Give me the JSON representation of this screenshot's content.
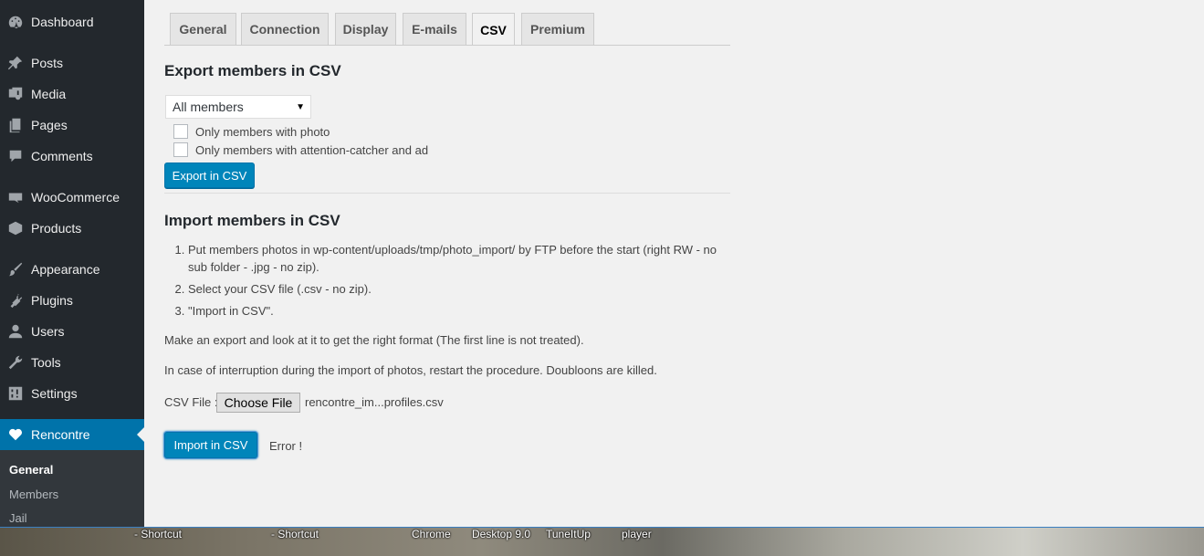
{
  "sidebar": {
    "items": [
      {
        "label": "Dashboard",
        "icon": "dashboard-icon"
      },
      {
        "label": "Posts",
        "icon": "pin-icon"
      },
      {
        "label": "Media",
        "icon": "media-icon"
      },
      {
        "label": "Pages",
        "icon": "pages-icon"
      },
      {
        "label": "Comments",
        "icon": "comment-icon"
      },
      {
        "label": "WooCommerce",
        "icon": "woocommerce-icon"
      },
      {
        "label": "Products",
        "icon": "products-icon"
      },
      {
        "label": "Appearance",
        "icon": "brush-icon"
      },
      {
        "label": "Plugins",
        "icon": "plug-icon"
      },
      {
        "label": "Users",
        "icon": "user-icon"
      },
      {
        "label": "Tools",
        "icon": "wrench-icon"
      },
      {
        "label": "Settings",
        "icon": "settings-icon"
      },
      {
        "label": "Rencontre",
        "icon": "heart-icon"
      }
    ],
    "submenu": [
      "General",
      "Members",
      "Jail"
    ]
  },
  "tabs": [
    "General",
    "Connection",
    "Display",
    "E-mails",
    "CSV",
    "Premium"
  ],
  "active_tab": "CSV",
  "export": {
    "title": "Export members in CSV",
    "select_value": "All members",
    "checkbox1": "Only members with photo",
    "checkbox2": "Only members with attention-catcher and ad",
    "button": "Export in CSV"
  },
  "import": {
    "title": "Import members in CSV",
    "steps": [
      "Put members photos in wp-content/uploads/tmp/photo_import/ by FTP before the start (right RW - no sub folder - .jpg - no zip).",
      "Select your CSV file (.csv - no zip).",
      "\"Import in CSV\"."
    ],
    "note1": "Make an export and look at it to get the right format (The first line is not treated).",
    "note2": "In case of interruption during the import of photos, restart the procedure. Doubloons are killed.",
    "file_label": "CSV File :",
    "choose_file": "Choose File",
    "file_name": "rencontre_im...profiles.csv",
    "button": "Import in CSV",
    "error": "Error !"
  },
  "taskbar": [
    "- Shortcut",
    "- Shortcut",
    "Chrome",
    "Desktop 9.0",
    "TuneItUp",
    "player"
  ],
  "colors": {
    "sidebar": "#23282d",
    "accent": "#0073aa",
    "button": "#0085ba"
  }
}
